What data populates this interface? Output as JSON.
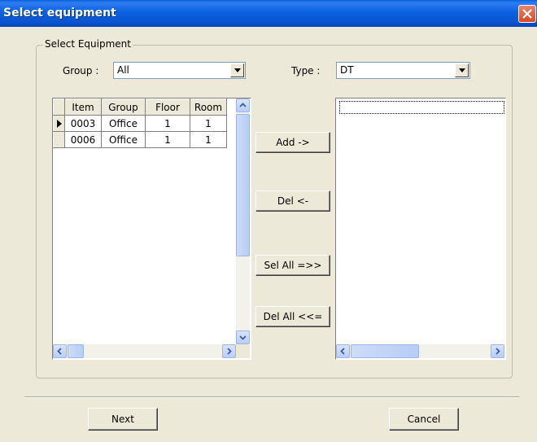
{
  "window": {
    "title": "Select equipment"
  },
  "group_box": {
    "label": "Select Equipment"
  },
  "filters": {
    "group_label": "Group :",
    "group_value": "All",
    "type_label": "Type :",
    "type_value": "DT"
  },
  "table": {
    "columns": [
      "Item",
      "Group",
      "Floor",
      "Room"
    ],
    "rows": [
      {
        "item": "0003",
        "group": "Office",
        "floor": "1",
        "room": "1",
        "current": true
      },
      {
        "item": "0006",
        "group": "Office",
        "floor": "1",
        "room": "1",
        "current": false
      }
    ]
  },
  "actions": {
    "add": "Add ->",
    "del": "Del <-",
    "sel_all": "Sel All =>>",
    "del_all": "Del All <<="
  },
  "footer": {
    "next": "Next",
    "cancel": "Cancel"
  },
  "icons": {
    "close": "close-icon",
    "dropdown": "chevron-down-icon",
    "row_indicator": "row-pointer-icon",
    "scroll_up": "arrow-up-icon",
    "scroll_down": "arrow-down-icon",
    "scroll_left": "arrow-left-icon",
    "scroll_right": "arrow-right-icon"
  },
  "colors": {
    "titlebar": "#0A55D2",
    "close": "#D54A25",
    "dialog": "#ECE9D8"
  }
}
